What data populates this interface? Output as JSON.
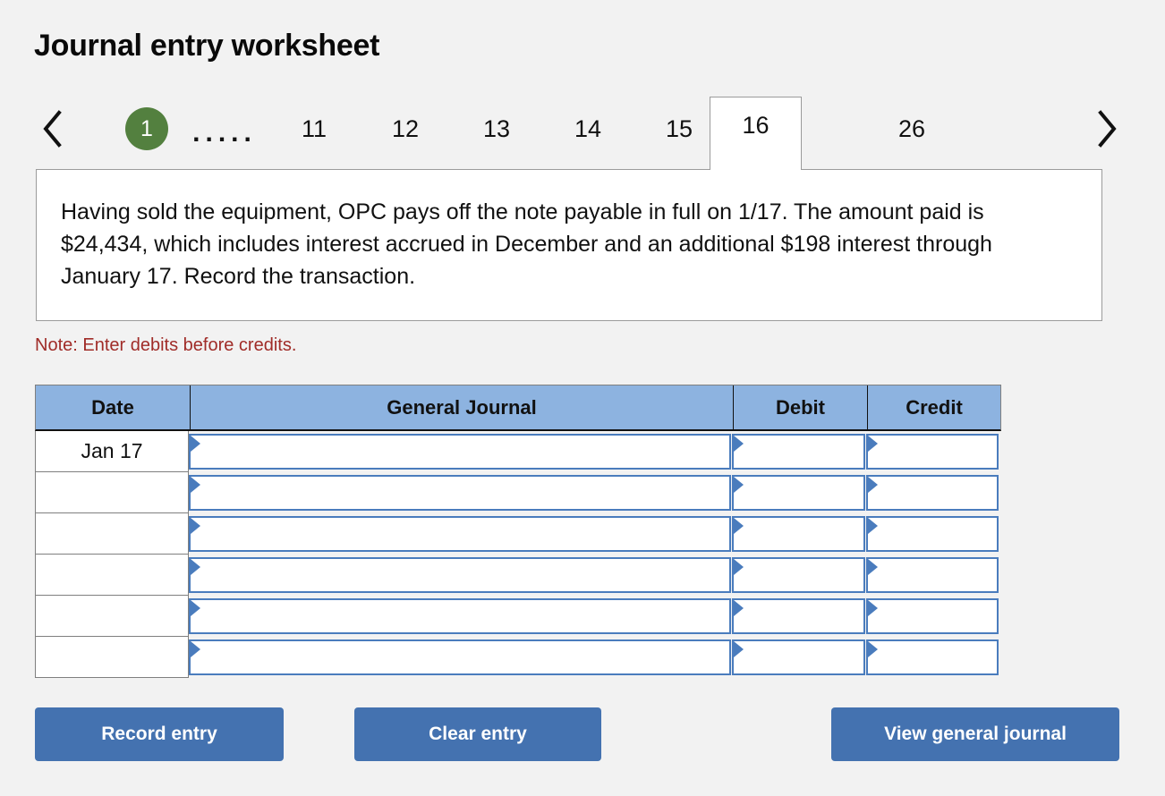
{
  "page": {
    "title": "Journal entry worksheet",
    "background_color": "#f2f2f2"
  },
  "tabs": {
    "prev_label": "‹",
    "next_label": "›",
    "prev_icon": "chevron-left-icon",
    "next_icon": "chevron-right-icon",
    "dots": ".....",
    "active_index": 7,
    "badge_color": "#53803f",
    "items": [
      {
        "label": "1",
        "type": "badge",
        "active": false
      },
      {
        "label": ".....",
        "type": "dots",
        "active": false
      },
      {
        "label": "11",
        "type": "number",
        "active": false
      },
      {
        "label": "12",
        "type": "number",
        "active": false
      },
      {
        "label": "13",
        "type": "number",
        "active": false
      },
      {
        "label": "14",
        "type": "number",
        "active": false
      },
      {
        "label": "15",
        "type": "number",
        "active": false
      },
      {
        "label": "16",
        "type": "number",
        "active": true
      },
      {
        "label": "26",
        "type": "number",
        "active": false
      }
    ]
  },
  "description": {
    "text": "Having sold the equipment, OPC pays off the note payable in full on 1/17. The amount paid is $24,434, which includes interest accrued in December and an additional $198 interest through January 17. Record the transaction."
  },
  "note": {
    "text": "Note: Enter debits before credits.",
    "color": "#a02c28"
  },
  "journal_table": {
    "header_background": "#8db3e0",
    "columns": [
      {
        "key": "date",
        "label": "Date"
      },
      {
        "key": "general",
        "label": "General Journal"
      },
      {
        "key": "debit",
        "label": "Debit"
      },
      {
        "key": "credit",
        "label": "Credit"
      }
    ],
    "rows": [
      {
        "date": "Jan 17",
        "general": "",
        "debit": "",
        "credit": ""
      },
      {
        "date": "",
        "general": "",
        "debit": "",
        "credit": ""
      },
      {
        "date": "",
        "general": "",
        "debit": "",
        "credit": ""
      },
      {
        "date": "",
        "general": "",
        "debit": "",
        "credit": ""
      },
      {
        "date": "",
        "general": "",
        "debit": "",
        "credit": ""
      },
      {
        "date": "",
        "general": "",
        "debit": "",
        "credit": ""
      }
    ]
  },
  "buttons": {
    "color": "#4472b0",
    "record": "Record entry",
    "clear": "Clear entry",
    "view": "View general journal"
  }
}
